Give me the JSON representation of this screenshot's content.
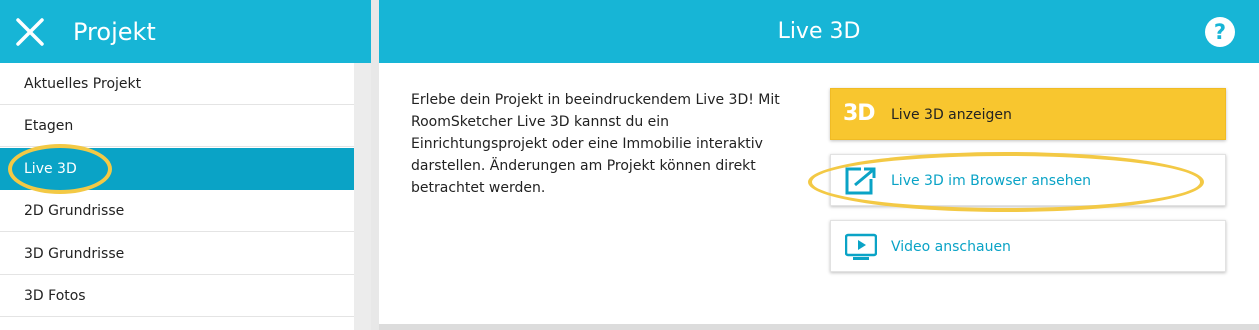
{
  "sidebar": {
    "title": "Projekt",
    "items": [
      {
        "label": "Aktuelles Projekt"
      },
      {
        "label": "Etagen"
      },
      {
        "label": "Live 3D"
      },
      {
        "label": "2D Grundrisse"
      },
      {
        "label": "3D Grundrisse"
      },
      {
        "label": "3D Fotos"
      }
    ],
    "active_index": 2
  },
  "main": {
    "title": "Live 3D",
    "help_label": "?",
    "description": "Erlebe dein Projekt in beeindruckendem Live 3D! Mit RoomSketcher Live 3D kannst du ein Einrichtungsprojekt oder eine Immobilie interaktiv darstellen. Änderungen am Projekt können direkt betrachtet werden.",
    "actions": [
      {
        "icon": "3d-icon",
        "icon_text": "3D",
        "label": "Live 3D anzeigen"
      },
      {
        "icon": "external-link-icon",
        "label": "Live 3D im Browser ansehen"
      },
      {
        "icon": "video-play-icon",
        "label": "Video anschauen"
      }
    ]
  },
  "colors": {
    "accent": "#17b5d6",
    "active_item": "#0aa3c6",
    "primary_button": "#f8c62f",
    "highlight_ring": "#f3c945"
  }
}
